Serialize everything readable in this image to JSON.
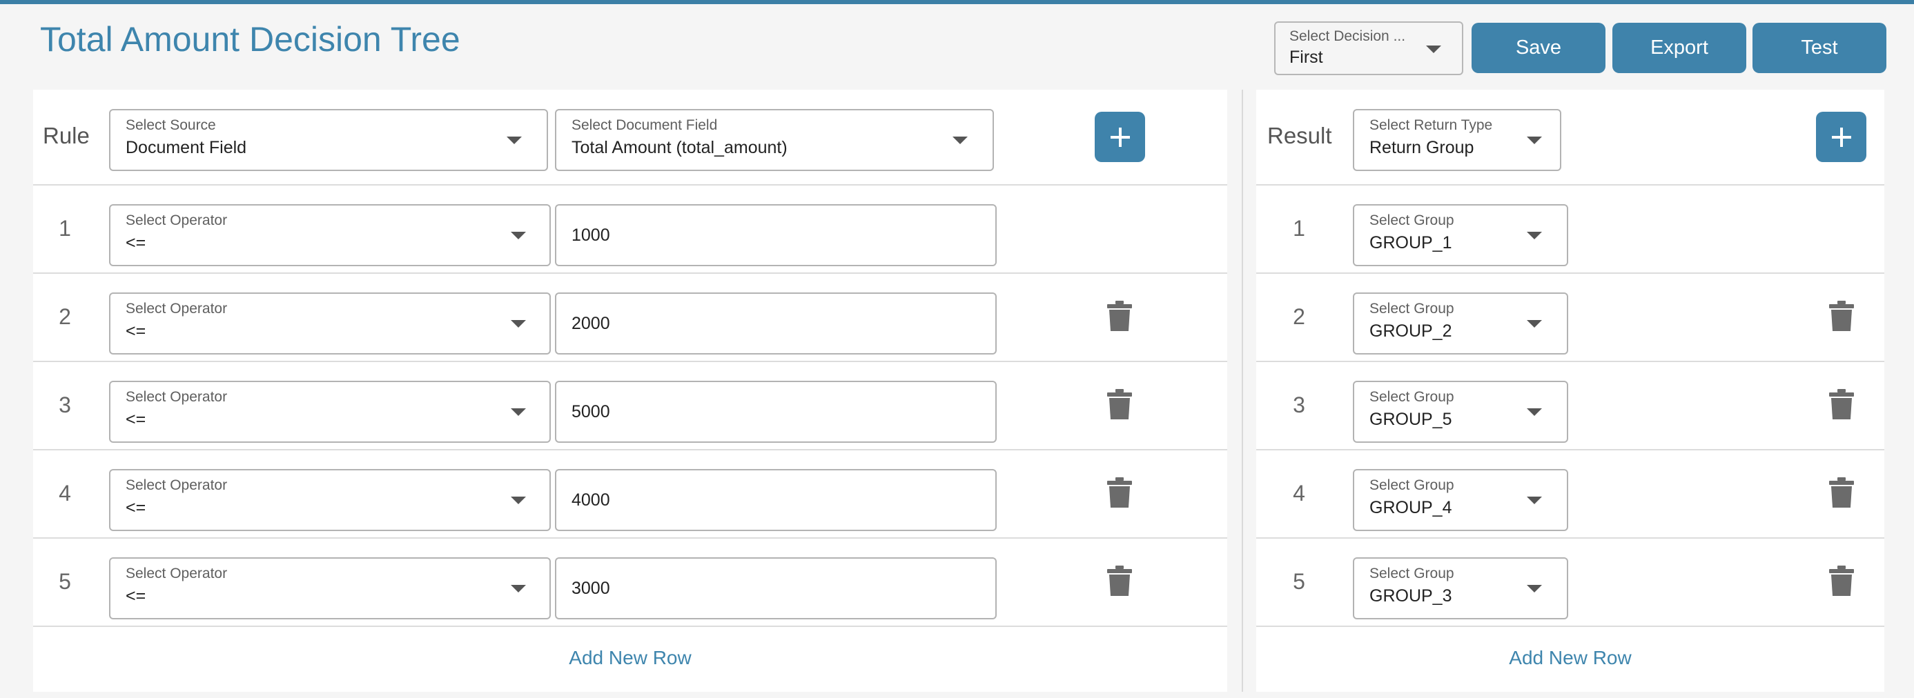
{
  "header": {
    "title": "Total Amount Decision Tree",
    "decision_select": {
      "label": "Select Decision ...",
      "value": "First"
    },
    "save_label": "Save",
    "export_label": "Export",
    "test_label": "Test"
  },
  "rule_panel": {
    "heading": "Rule",
    "source_select": {
      "label": "Select Source",
      "value": "Document Field"
    },
    "document_field_select": {
      "label": "Select Document Field",
      "value": "Total Amount (total_amount)"
    },
    "rows": [
      {
        "num": "1",
        "operator_label": "Select Operator",
        "operator": "<=",
        "value": "1000"
      },
      {
        "num": "2",
        "operator_label": "Select Operator",
        "operator": "<=",
        "value": "2000"
      },
      {
        "num": "3",
        "operator_label": "Select Operator",
        "operator": "<=",
        "value": "5000"
      },
      {
        "num": "4",
        "operator_label": "Select Operator",
        "operator": "<=",
        "value": "4000"
      },
      {
        "num": "5",
        "operator_label": "Select Operator",
        "operator": "<=",
        "value": "3000"
      }
    ],
    "add_row_label": "Add New Row"
  },
  "result_panel": {
    "heading": "Result",
    "return_type_select": {
      "label": "Select Return Type",
      "value": "Return Group"
    },
    "rows": [
      {
        "num": "1",
        "group_label": "Select Group",
        "group": "GROUP_1"
      },
      {
        "num": "2",
        "group_label": "Select Group",
        "group": "GROUP_2"
      },
      {
        "num": "3",
        "group_label": "Select Group",
        "group": "GROUP_5"
      },
      {
        "num": "4",
        "group_label": "Select Group",
        "group": "GROUP_4"
      },
      {
        "num": "5",
        "group_label": "Select Group",
        "group": "GROUP_3"
      }
    ],
    "add_row_label": "Add New Row"
  },
  "icons": {
    "add": "plus-icon",
    "delete": "trash-icon",
    "dropdown": "caret-down-icon"
  },
  "colors": {
    "accent": "#3f83ab",
    "title": "#3e85ad",
    "background": "#f5f5f5"
  }
}
